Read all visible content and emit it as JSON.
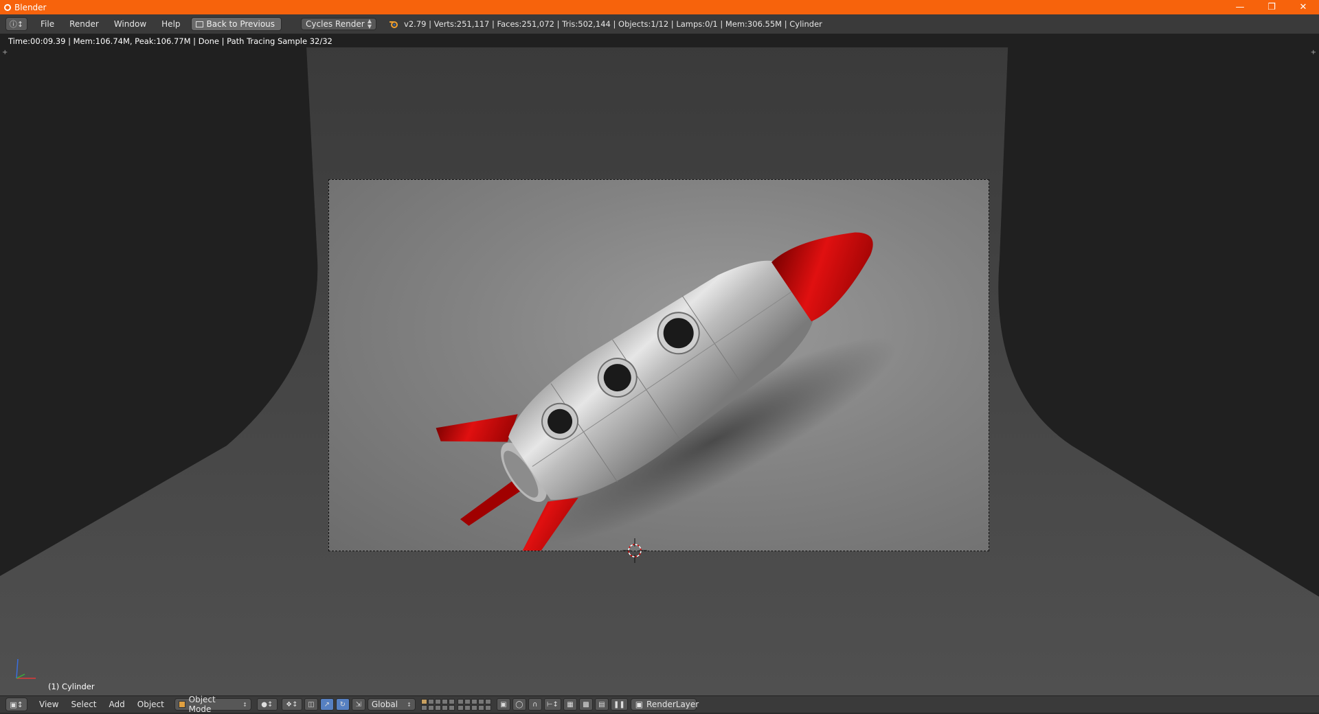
{
  "window": {
    "title": "Blender",
    "controls": [
      "minimize",
      "restore",
      "close"
    ]
  },
  "info_header": {
    "editor_type_icon": "info-icon",
    "menus": [
      "File",
      "Render",
      "Window",
      "Help"
    ],
    "back_button_label": "Back to Previous",
    "render_engine": "Cycles Render",
    "stats": "v2.79 | Verts:251,117 | Faces:251,072 | Tris:502,144 | Objects:1/12 | Lamps:0/1 | Mem:306.55M | Cylinder"
  },
  "viewport": {
    "render_status": "Time:00:09.39 | Mem:106.74M, Peak:106.77M | Done | Path Tracing Sample 32/32",
    "object_label": "(1) Cylinder"
  },
  "bottom_header": {
    "editor_type_icon": "3d-view-icon",
    "menus": [
      "View",
      "Select",
      "Add",
      "Object"
    ],
    "mode": "Object Mode",
    "transform_orientation": "Global",
    "render_layer": "RenderLayer"
  },
  "colors": {
    "titlebar": "#f7630c",
    "header": "#3a3a3a",
    "rocket_red": "#b30000",
    "rocket_body": "#c8c8c8"
  }
}
